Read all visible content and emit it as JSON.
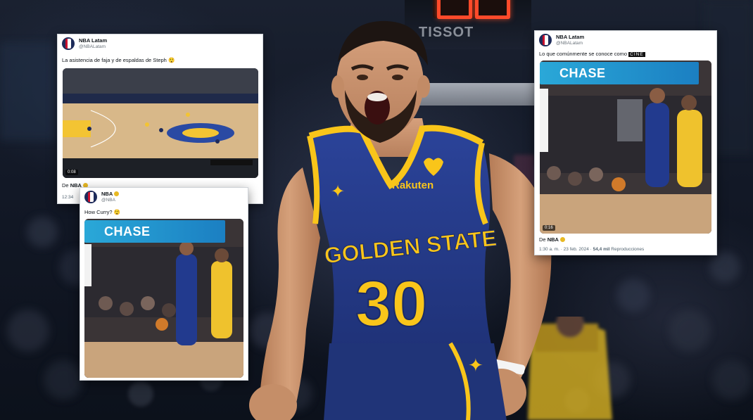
{
  "scene": {
    "scoreboard_sponsor": "TISSOT",
    "jersey": {
      "team": "GOLDEN STATE",
      "number": "30",
      "sponsor": "Rakuten"
    }
  },
  "tweets": [
    {
      "author_name": "NBA Latam",
      "author_handle": "@NBALatam",
      "text": "La asistencia de faja y de espaldas de Steph 😲",
      "video_time": "0:08",
      "via_prefix": "De",
      "via_account": "NBA",
      "footer": "12:34"
    },
    {
      "author_name": "NBA",
      "author_handle": "@NBA",
      "text": "How Curry? 😲",
      "court_sign": "CHASE"
    },
    {
      "author_name": "NBA Latam",
      "author_handle": "@NBALatam",
      "text_prefix": "Lo que comúnmente se conoce como",
      "text_badge": "CINE",
      "court_sign": "CHASE",
      "video_time": "0:16",
      "via_prefix": "De",
      "via_account": "NBA",
      "footer_time": "1:30 a. m. · 23 feb. 2024 ·",
      "footer_views": "54,4 mil",
      "footer_views_label": "Reproducciones"
    }
  ],
  "colors": {
    "warriors_blue": "#233a8e",
    "warriors_gold": "#f9c51a",
    "chase_blue": "#2aa8d8"
  }
}
